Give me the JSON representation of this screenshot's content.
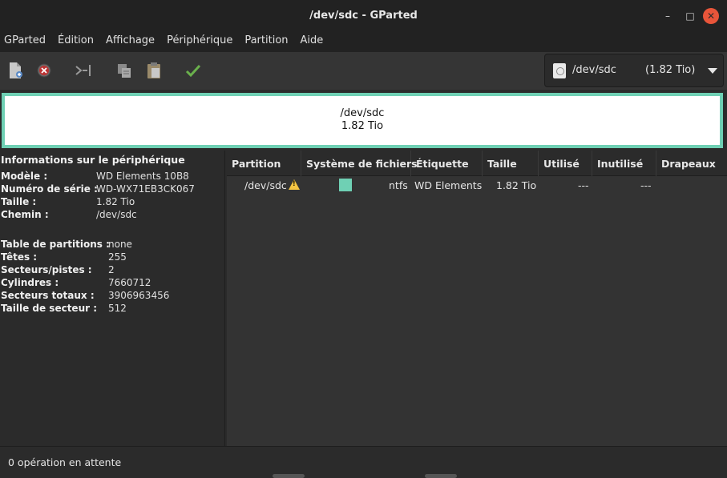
{
  "window": {
    "title": "/dev/sdc - GParted"
  },
  "menu": [
    "GParted",
    "Édition",
    "Affichage",
    "Périphérique",
    "Partition",
    "Aide"
  ],
  "toolbar": {
    "icons": [
      "new-partition-icon",
      "delete-icon",
      "resize-move-icon",
      "copy-icon",
      "paste-icon",
      "apply-icon"
    ]
  },
  "device_selector": {
    "name": "/dev/sdc",
    "size": "(1.82 Tio)"
  },
  "disk_map": {
    "name": "/dev/sdc",
    "size": "1.82 Tio",
    "color": "#6fd0b4"
  },
  "info": {
    "heading": "Informations sur le périphérique",
    "rows1": [
      {
        "k": "Modèle :",
        "v": "WD Elements 10B8"
      },
      {
        "k": "Numéro de série :",
        "v": "WD-WX71EB3CK067"
      },
      {
        "k": "Taille :",
        "v": "1.82 Tio"
      },
      {
        "k": "Chemin :",
        "v": "/dev/sdc"
      }
    ],
    "rows2": [
      {
        "k": "Table de partitions :",
        "v": "none"
      },
      {
        "k": "Têtes :",
        "v": "255"
      },
      {
        "k": "Secteurs/pistes :",
        "v": "2"
      },
      {
        "k": "Cylindres :",
        "v": "7660712"
      },
      {
        "k": "Secteurs totaux :",
        "v": "3906963456"
      },
      {
        "k": "Taille de secteur :",
        "v": "512"
      }
    ]
  },
  "table": {
    "columns": [
      "Partition",
      "Système de fichiers",
      "Étiquette",
      "Taille",
      "Utilisé",
      "Inutilisé",
      "Drapeaux"
    ],
    "rows": [
      {
        "partition": "/dev/sdc",
        "fs": "ntfs",
        "label": "WD Elements",
        "size": "1.82 Tio",
        "used": "---",
        "unused": "---",
        "flags": ""
      }
    ]
  },
  "status": {
    "text": "0 opération en attente"
  }
}
